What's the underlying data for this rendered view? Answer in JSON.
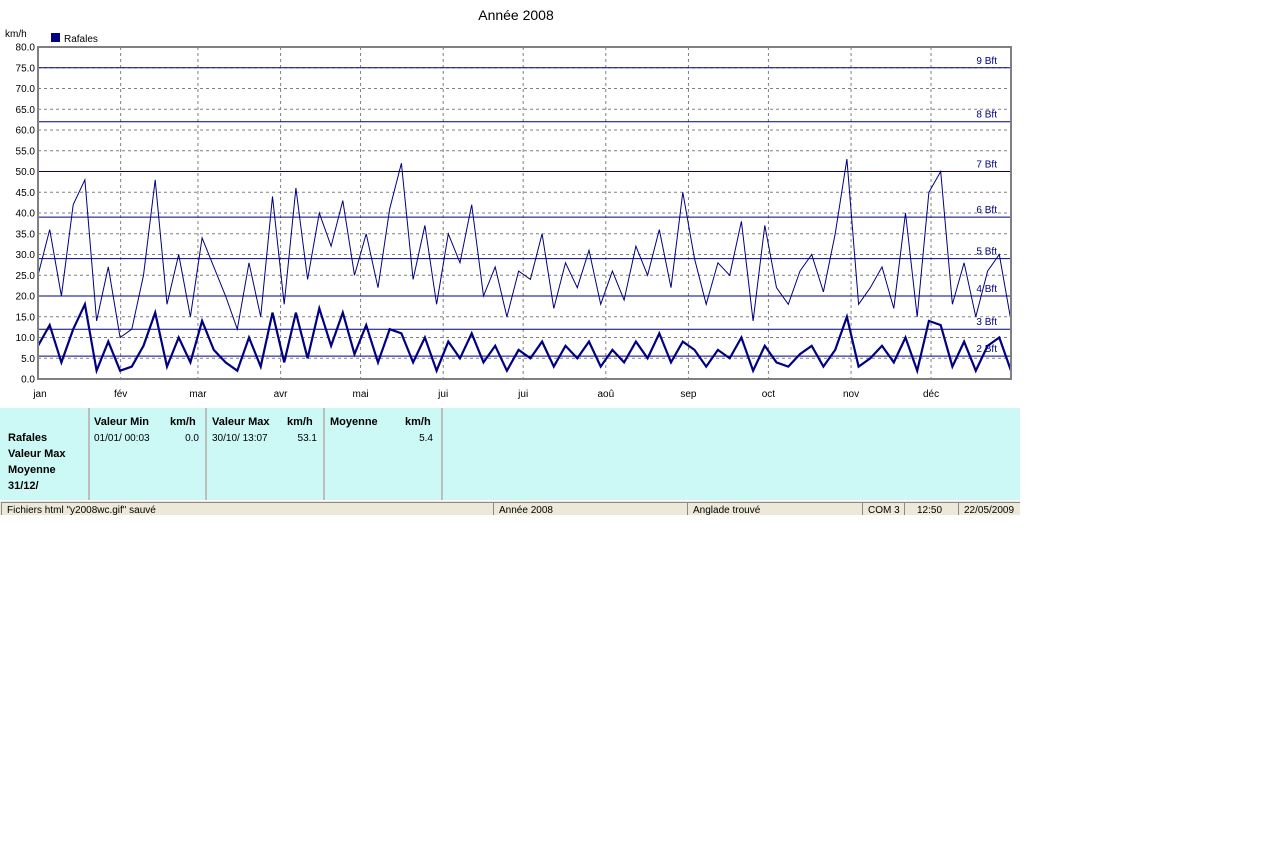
{
  "chart_data": {
    "type": "line",
    "title": "Année 2008",
    "ylabel": "km/h",
    "ylim": [
      0,
      80
    ],
    "yticks": [
      "0.0",
      "5.0",
      "10.0",
      "15.0",
      "20.0",
      "25.0",
      "30.0",
      "35.0",
      "40.0",
      "45.0",
      "50.0",
      "55.0",
      "60.0",
      "65.0",
      "70.0",
      "75.0",
      "80.0"
    ],
    "months": [
      "jan",
      "fév",
      "mar",
      "avr",
      "mai",
      "jui",
      "jui",
      "aoû",
      "sep",
      "oct",
      "nov",
      "déc"
    ],
    "grid": true,
    "legend": {
      "position": "top-left",
      "label": "Rafales",
      "color": "#000080"
    },
    "beaufort": [
      {
        "label": "2 Bft",
        "value": 5.5
      },
      {
        "label": "3 Bft",
        "value": 12
      },
      {
        "label": "4 Bft",
        "value": 20
      },
      {
        "label": "5 Bft",
        "value": 29
      },
      {
        "label": "6 Bft",
        "value": 39
      },
      {
        "label": "7 Bft",
        "value": 50
      },
      {
        "label": "8 Bft",
        "value": 62
      },
      {
        "label": "9 Bft",
        "value": 75
      }
    ],
    "series": [
      {
        "name": "Rafales",
        "color": "#000080",
        "x_days": [
          0,
          5,
          9,
          14,
          19,
          24,
          30,
          34,
          38,
          44,
          49,
          55,
          59,
          64,
          69,
          74,
          79,
          84,
          89,
          94,
          99,
          104,
          109,
          114,
          119,
          124,
          129,
          134,
          139,
          144,
          149,
          154,
          159,
          164,
          169,
          174,
          179,
          184,
          189,
          194,
          199,
          204,
          209,
          214,
          219,
          224,
          229,
          234,
          239,
          244,
          249,
          254,
          259,
          264,
          269,
          274,
          279,
          284,
          289,
          294,
          299,
          303,
          305,
          309,
          314,
          319,
          324,
          329,
          334,
          337,
          339,
          344,
          349,
          354,
          359,
          365
        ],
        "upper": [
          25,
          36,
          20,
          42,
          48,
          14,
          27,
          10,
          12,
          25,
          48,
          18,
          30,
          15,
          34,
          27,
          20,
          12,
          28,
          15,
          44,
          18,
          46,
          24,
          40,
          32,
          43,
          25,
          35,
          22,
          41,
          52,
          24,
          37,
          18,
          35,
          28,
          42,
          20,
          27,
          15,
          26,
          24,
          35,
          17,
          28,
          22,
          31,
          18,
          26,
          19,
          32,
          25,
          36,
          22,
          45,
          29,
          18,
          28,
          25,
          38,
          14,
          37,
          22,
          18,
          26,
          30,
          21,
          35,
          53,
          18,
          22,
          27,
          17,
          40,
          15,
          45,
          50,
          18,
          28,
          15,
          26,
          30,
          14
        ],
        "lower": [
          8,
          13,
          4,
          12,
          18,
          2,
          9,
          2,
          3,
          8,
          16,
          3,
          10,
          4,
          14,
          7,
          4,
          2,
          10,
          3,
          16,
          4,
          16,
          5,
          17,
          8,
          16,
          6,
          13,
          4,
          12,
          11,
          4,
          10,
          2,
          9,
          5,
          11,
          4,
          8,
          2,
          7,
          5,
          9,
          3,
          8,
          5,
          9,
          3,
          7,
          4,
          9,
          5,
          11,
          4,
          9,
          7,
          3,
          7,
          5,
          10,
          2,
          8,
          4,
          3,
          6,
          8,
          3,
          7,
          15,
          3,
          5,
          8,
          4,
          10,
          2,
          14,
          13,
          3,
          9,
          2,
          8,
          10,
          2
        ]
      }
    ]
  },
  "panel": {
    "row_labels": [
      "Rafales",
      "Valeur Max",
      "Moyenne",
      "31/12/"
    ],
    "min": {
      "title": "Valeur Min",
      "unit": "km/h",
      "date": "01/01/  00:03",
      "value": "0.0"
    },
    "max": {
      "title": "Valeur Max",
      "unit": "km/h",
      "date": "30/10/  13:07",
      "value": "53.1"
    },
    "avg": {
      "title": "Moyenne",
      "unit": "km/h",
      "value": "5.4"
    }
  },
  "statusbar": {
    "file": "Fichiers html  \"y2008wc.gif\"  sauvé",
    "year": "Année 2008",
    "station": "Anglade trouvé",
    "port": "COM 3",
    "time": "12:50",
    "date": "22/05/2009"
  }
}
